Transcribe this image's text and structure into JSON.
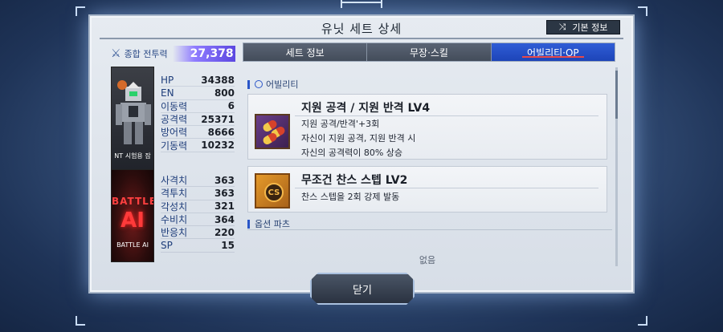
{
  "header": {
    "title": "유닛 세트 상세",
    "basic_info_label": "기본 정보"
  },
  "power": {
    "label": "종합 전투력",
    "value": "27,378"
  },
  "unit_card": {
    "label": "NT 시험용 잠"
  },
  "ai_card": {
    "big": "BATTLE",
    "ai": "AI",
    "label": "BATTLE AI"
  },
  "stats1": [
    {
      "name": "HP",
      "value": "34388"
    },
    {
      "name": "EN",
      "value": "800"
    },
    {
      "name": "이동력",
      "value": "6"
    },
    {
      "name": "공격력",
      "value": "25371"
    },
    {
      "name": "방어력",
      "value": "8666"
    },
    {
      "name": "기동력",
      "value": "10232"
    }
  ],
  "stats2": [
    {
      "name": "사격치",
      "value": "363"
    },
    {
      "name": "격투치",
      "value": "363"
    },
    {
      "name": "각성치",
      "value": "321"
    },
    {
      "name": "수비치",
      "value": "364"
    },
    {
      "name": "반응치",
      "value": "220"
    },
    {
      "name": "SP",
      "value": "15"
    }
  ],
  "tabs": [
    "세트 정보",
    "무장·스킬",
    "어빌리티·OP"
  ],
  "sections": {
    "ability": "어빌리티",
    "option": "옵션 파츠",
    "none": "없음"
  },
  "abilities": [
    {
      "title": "지원 공격 / 지원 반격 LV4",
      "desc": [
        "지원 공격/반격'+3회",
        "자신이 지원 공격, 지원 반격 시",
        "자신의 공격력이 80% 상승"
      ]
    },
    {
      "title": "무조건 찬스 스텝 LV2",
      "badge": "CS",
      "desc": [
        "찬스 스텝을 2회 강제 발동"
      ]
    }
  ],
  "close_label": "닫기"
}
